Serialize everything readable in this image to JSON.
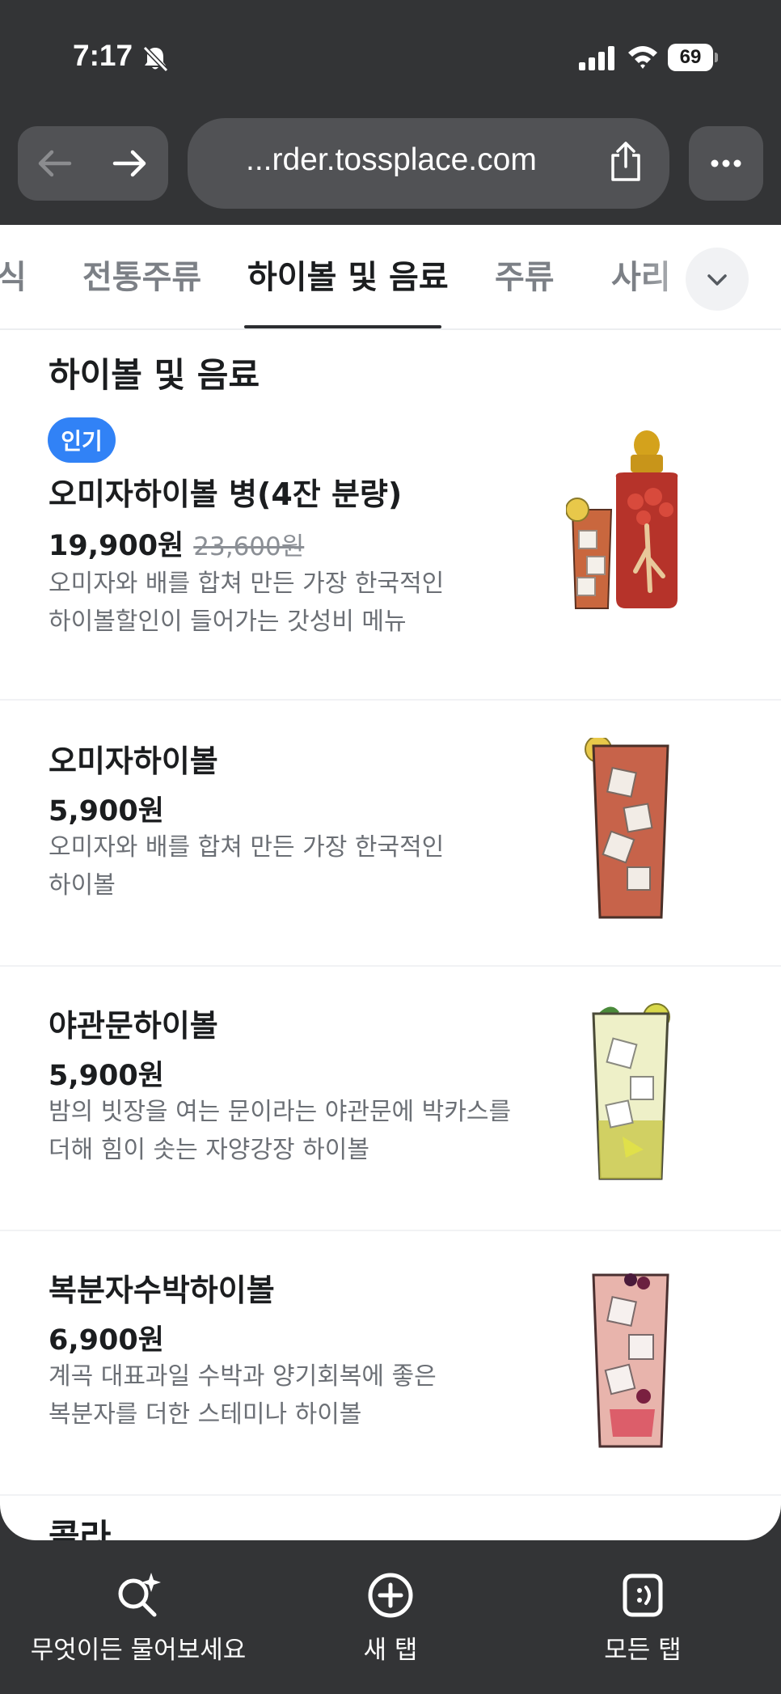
{
  "status_bar": {
    "time": "7:17",
    "battery": "69",
    "icons": [
      "bell-slash-icon",
      "cellular-signal-icon",
      "wifi-icon",
      "battery-icon"
    ]
  },
  "browser": {
    "url": "...rder.tossplace.com",
    "icons": [
      "back-arrow-icon",
      "forward-arrow-icon",
      "share-icon",
      "more-icon"
    ]
  },
  "tabs": [
    {
      "label": "식",
      "active": false
    },
    {
      "label": "전통주류",
      "active": false
    },
    {
      "label": "하이볼 및 음료",
      "active": true
    },
    {
      "label": "주류",
      "active": false
    },
    {
      "label": "사리",
      "active": false
    }
  ],
  "section": {
    "title": "하이볼 및 음료"
  },
  "items": [
    {
      "badge": "인기",
      "name": "오미자하이볼 병(4잔 분량)",
      "price": "19,900원",
      "original_price": "23,600원",
      "desc_line1": "오미자와 배를 합쳐 만든 가장 한국적인",
      "desc_line2": "하이볼할인이 들어가는 갓성비 메뉴"
    },
    {
      "name": "오미자하이볼",
      "price": "5,900원",
      "desc_line1": "오미자와 배를 합쳐 만든 가장 한국적인",
      "desc_line2": "하이볼"
    },
    {
      "name": "야관문하이볼",
      "price": "5,900원",
      "desc_line1": "밤의 빗장을 여는 문이라는 야관문에 박카스를",
      "desc_line2": "더해 힘이 솟는 자양강장 하이볼"
    },
    {
      "name": "복분자수박하이볼",
      "price": "6,900원",
      "desc_line1": "계곡 대표과일 수박과 양기회복에 좋은",
      "desc_line2": "복분자를 더한 스테미나 하이볼"
    }
  ],
  "next_section_peek": "콜라",
  "bottom_bar": {
    "ask_label": "무엇이든 물어보세요",
    "new_tab_label": "새 탭",
    "all_tabs_label": "모든 탭"
  },
  "colors": {
    "chrome_bg": "#333436",
    "control_bg": "#515255",
    "badge_blue": "#3182f6"
  }
}
